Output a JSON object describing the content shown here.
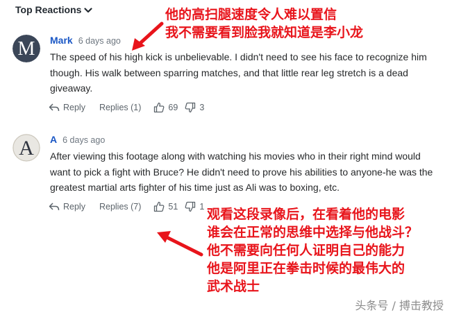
{
  "sort": {
    "label": "Top Reactions"
  },
  "comments": [
    {
      "avatar_letter": "M",
      "author": "Mark",
      "time": "6 days ago",
      "text": "The speed of his high kick is unbelievable. I didn't need to see his face to recognize him though. His walk between sparring matches, and that little rear leg stretch is a dead giveaway.",
      "reply_label": "Reply",
      "replies_label": "Replies (1)",
      "likes": "69",
      "dislikes": "3"
    },
    {
      "avatar_letter": "A",
      "author": "A",
      "time": "6 days ago",
      "text": "After viewing this footage along with watching his movies who in their right mind would want to pick a fight with Bruce? He didn't need to prove his abilities to anyone-he was the greatest martial arts fighter of his time just as Ali was to boxing, etc.",
      "reply_label": "Reply",
      "replies_label": "Replies (7)",
      "likes": "51",
      "dislikes": "1"
    }
  ],
  "annotations": {
    "top": [
      "他的高扫腿速度令人难以置信",
      "我不需要看到脸我就知道是李小龙"
    ],
    "bottom": [
      "观看这段录像后，在看着他的电影",
      "谁会在正常的思维中选择与他战斗？",
      "他不需要向任何人证明自己的能力",
      "他是阿里正在拳击时候的最伟大的",
      "武术战士"
    ]
  },
  "watermark": {
    "text": "头条号 / 搏击教授"
  },
  "colors": {
    "annotation": "#e8141b",
    "author": "#1a57c5",
    "avatar_mark": "#3b4658"
  },
  "icons": [
    "chevron-down-icon",
    "reply-icon",
    "thumbs-up-icon",
    "thumbs-down-icon"
  ]
}
